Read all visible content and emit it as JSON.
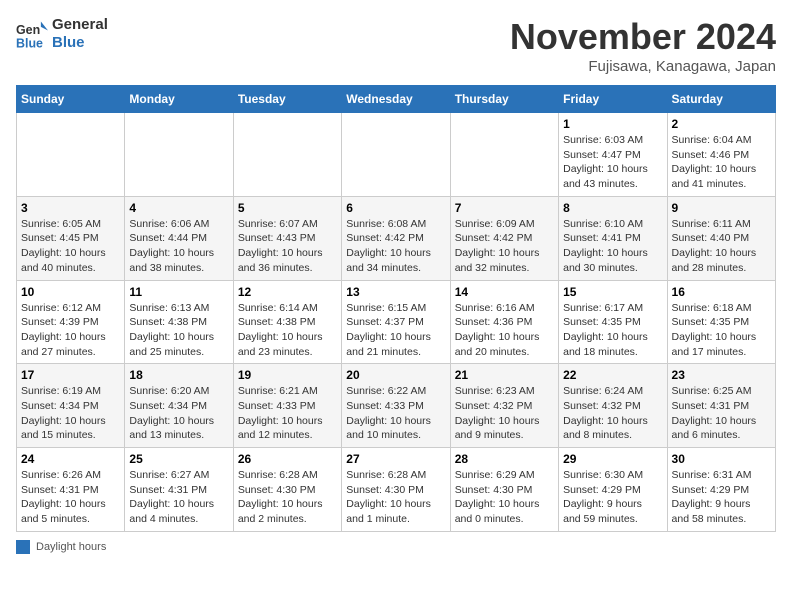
{
  "header": {
    "logo_line1": "General",
    "logo_line2": "Blue",
    "month_title": "November 2024",
    "location": "Fujisawa, Kanagawa, Japan"
  },
  "days_of_week": [
    "Sunday",
    "Monday",
    "Tuesday",
    "Wednesday",
    "Thursday",
    "Friday",
    "Saturday"
  ],
  "weeks": [
    [
      {
        "day": "",
        "info": ""
      },
      {
        "day": "",
        "info": ""
      },
      {
        "day": "",
        "info": ""
      },
      {
        "day": "",
        "info": ""
      },
      {
        "day": "",
        "info": ""
      },
      {
        "day": "1",
        "info": "Sunrise: 6:03 AM\nSunset: 4:47 PM\nDaylight: 10 hours\nand 43 minutes."
      },
      {
        "day": "2",
        "info": "Sunrise: 6:04 AM\nSunset: 4:46 PM\nDaylight: 10 hours\nand 41 minutes."
      }
    ],
    [
      {
        "day": "3",
        "info": "Sunrise: 6:05 AM\nSunset: 4:45 PM\nDaylight: 10 hours\nand 40 minutes."
      },
      {
        "day": "4",
        "info": "Sunrise: 6:06 AM\nSunset: 4:44 PM\nDaylight: 10 hours\nand 38 minutes."
      },
      {
        "day": "5",
        "info": "Sunrise: 6:07 AM\nSunset: 4:43 PM\nDaylight: 10 hours\nand 36 minutes."
      },
      {
        "day": "6",
        "info": "Sunrise: 6:08 AM\nSunset: 4:42 PM\nDaylight: 10 hours\nand 34 minutes."
      },
      {
        "day": "7",
        "info": "Sunrise: 6:09 AM\nSunset: 4:42 PM\nDaylight: 10 hours\nand 32 minutes."
      },
      {
        "day": "8",
        "info": "Sunrise: 6:10 AM\nSunset: 4:41 PM\nDaylight: 10 hours\nand 30 minutes."
      },
      {
        "day": "9",
        "info": "Sunrise: 6:11 AM\nSunset: 4:40 PM\nDaylight: 10 hours\nand 28 minutes."
      }
    ],
    [
      {
        "day": "10",
        "info": "Sunrise: 6:12 AM\nSunset: 4:39 PM\nDaylight: 10 hours\nand 27 minutes."
      },
      {
        "day": "11",
        "info": "Sunrise: 6:13 AM\nSunset: 4:38 PM\nDaylight: 10 hours\nand 25 minutes."
      },
      {
        "day": "12",
        "info": "Sunrise: 6:14 AM\nSunset: 4:38 PM\nDaylight: 10 hours\nand 23 minutes."
      },
      {
        "day": "13",
        "info": "Sunrise: 6:15 AM\nSunset: 4:37 PM\nDaylight: 10 hours\nand 21 minutes."
      },
      {
        "day": "14",
        "info": "Sunrise: 6:16 AM\nSunset: 4:36 PM\nDaylight: 10 hours\nand 20 minutes."
      },
      {
        "day": "15",
        "info": "Sunrise: 6:17 AM\nSunset: 4:35 PM\nDaylight: 10 hours\nand 18 minutes."
      },
      {
        "day": "16",
        "info": "Sunrise: 6:18 AM\nSunset: 4:35 PM\nDaylight: 10 hours\nand 17 minutes."
      }
    ],
    [
      {
        "day": "17",
        "info": "Sunrise: 6:19 AM\nSunset: 4:34 PM\nDaylight: 10 hours\nand 15 minutes."
      },
      {
        "day": "18",
        "info": "Sunrise: 6:20 AM\nSunset: 4:34 PM\nDaylight: 10 hours\nand 13 minutes."
      },
      {
        "day": "19",
        "info": "Sunrise: 6:21 AM\nSunset: 4:33 PM\nDaylight: 10 hours\nand 12 minutes."
      },
      {
        "day": "20",
        "info": "Sunrise: 6:22 AM\nSunset: 4:33 PM\nDaylight: 10 hours\nand 10 minutes."
      },
      {
        "day": "21",
        "info": "Sunrise: 6:23 AM\nSunset: 4:32 PM\nDaylight: 10 hours\nand 9 minutes."
      },
      {
        "day": "22",
        "info": "Sunrise: 6:24 AM\nSunset: 4:32 PM\nDaylight: 10 hours\nand 8 minutes."
      },
      {
        "day": "23",
        "info": "Sunrise: 6:25 AM\nSunset: 4:31 PM\nDaylight: 10 hours\nand 6 minutes."
      }
    ],
    [
      {
        "day": "24",
        "info": "Sunrise: 6:26 AM\nSunset: 4:31 PM\nDaylight: 10 hours\nand 5 minutes."
      },
      {
        "day": "25",
        "info": "Sunrise: 6:27 AM\nSunset: 4:31 PM\nDaylight: 10 hours\nand 4 minutes."
      },
      {
        "day": "26",
        "info": "Sunrise: 6:28 AM\nSunset: 4:30 PM\nDaylight: 10 hours\nand 2 minutes."
      },
      {
        "day": "27",
        "info": "Sunrise: 6:28 AM\nSunset: 4:30 PM\nDaylight: 10 hours\nand 1 minute."
      },
      {
        "day": "28",
        "info": "Sunrise: 6:29 AM\nSunset: 4:30 PM\nDaylight: 10 hours\nand 0 minutes."
      },
      {
        "day": "29",
        "info": "Sunrise: 6:30 AM\nSunset: 4:29 PM\nDaylight: 9 hours\nand 59 minutes."
      },
      {
        "day": "30",
        "info": "Sunrise: 6:31 AM\nSunset: 4:29 PM\nDaylight: 9 hours\nand 58 minutes."
      }
    ]
  ],
  "legend": {
    "label": "Daylight hours"
  }
}
